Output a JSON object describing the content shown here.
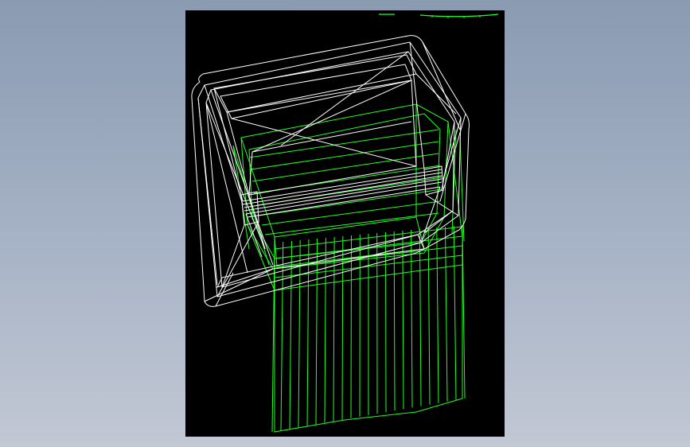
{
  "colors": {
    "background_top": "#8a9bb2",
    "background_bottom": "#c2c8d4",
    "viewport": "#000000",
    "wireframe_primary": "#ffffff",
    "wireframe_secondary": "#22ff22"
  },
  "icons": [
    "view-indicator-icon",
    "scale-indicator-icon"
  ]
}
